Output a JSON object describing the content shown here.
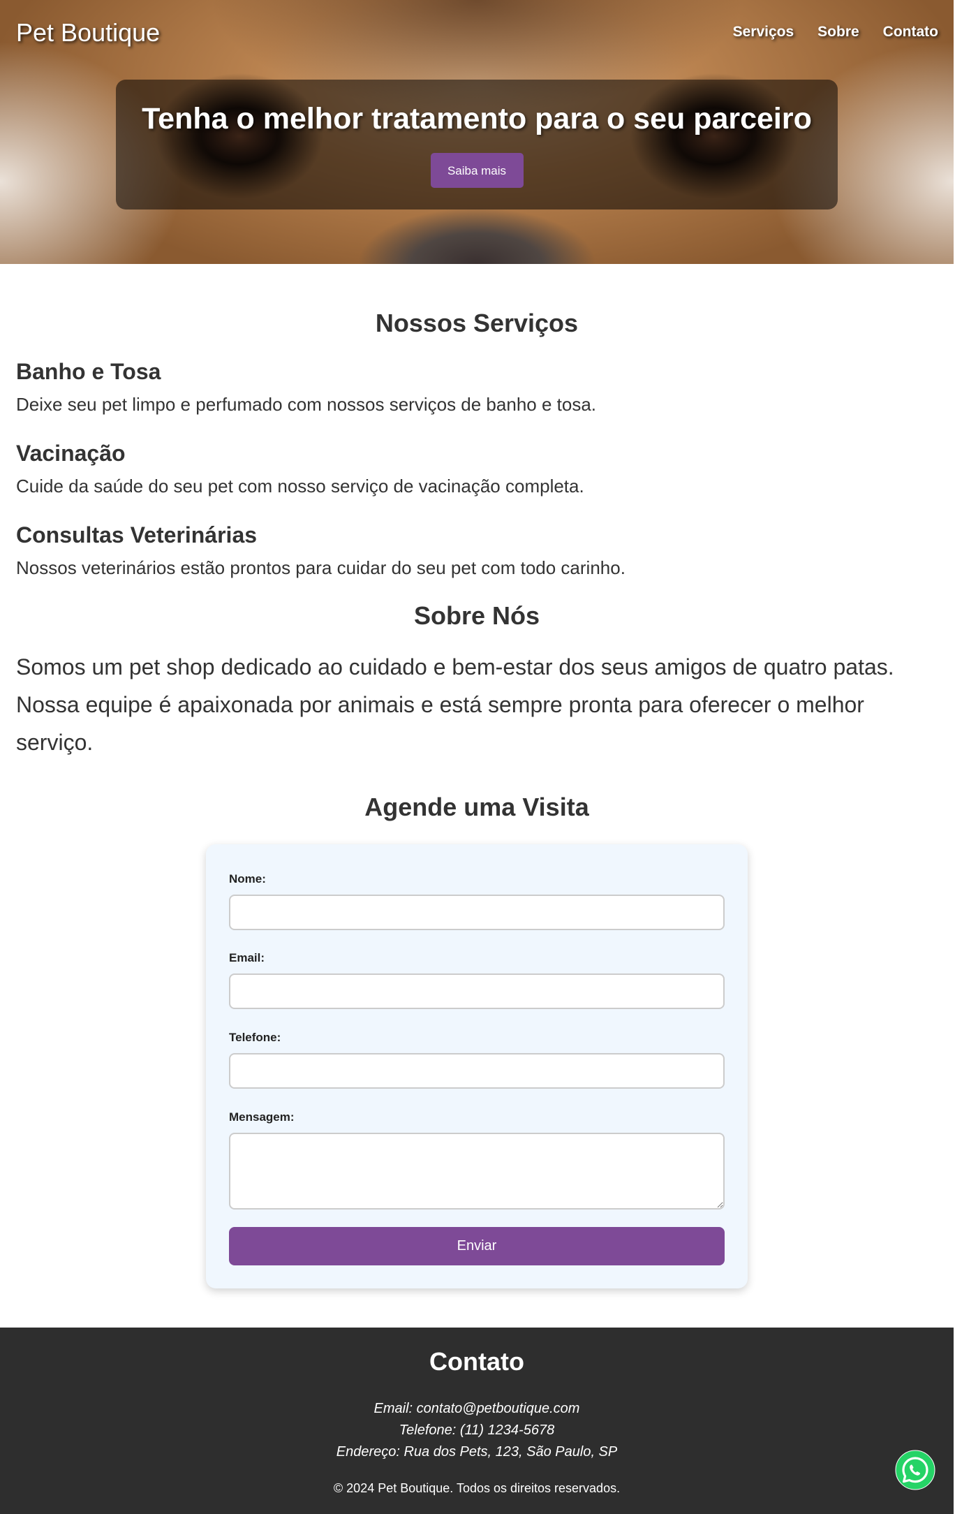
{
  "header": {
    "brand": "Pet Boutique",
    "nav": [
      "Serviços",
      "Sobre",
      "Contato"
    ]
  },
  "hero": {
    "title": "Tenha o melhor tratamento para o seu parceiro",
    "button_label": "Saiba mais"
  },
  "services": {
    "title": "Nossos Serviços",
    "items": [
      {
        "name": "Banho e Tosa",
        "description": "Deixe seu pet limpo e perfumado com nossos serviços de banho e tosa."
      },
      {
        "name": "Vacinação",
        "description": "Cuide da saúde do seu pet com nosso serviço de vacinação completa."
      },
      {
        "name": "Consultas Veterinárias",
        "description": "Nossos veterinários estão prontos para cuidar do seu pet com todo carinho."
      }
    ]
  },
  "about": {
    "title": "Sobre Nós",
    "text": "Somos um pet shop dedicado ao cuidado e bem-estar dos seus amigos de quatro patas. Nossa equipe é apaixonada por animais e está sempre pronta para oferecer o melhor serviço."
  },
  "booking": {
    "title": "Agende uma Visita",
    "fields": [
      {
        "label": "Nome:",
        "value": ""
      },
      {
        "label": "Email:",
        "value": ""
      },
      {
        "label": "Telefone:",
        "value": ""
      },
      {
        "label": "Mensagem:",
        "value": ""
      }
    ],
    "submit_label": "Enviar"
  },
  "footer": {
    "title": "Contato",
    "email": "Email: contato@petboutique.com",
    "phone": "Telefone: (11) 1234-5678",
    "address": "Endereço: Rua dos Pets, 123, São Paulo, SP",
    "copyright": "© 2024 Pet Boutique. Todos os direitos reservados."
  },
  "floating": {
    "icon": "whatsapp-icon"
  },
  "colors": {
    "accent": "#7e4a97",
    "footer_bg": "#2e2e2e",
    "form_bg": "#f0f7fe"
  }
}
